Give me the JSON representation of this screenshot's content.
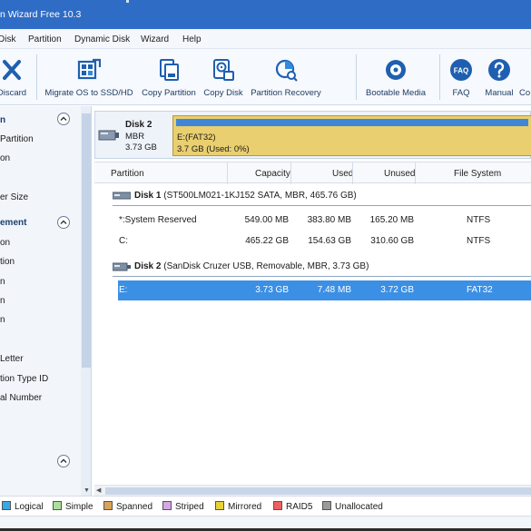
{
  "window": {
    "title": "n Wizard Free 10.3"
  },
  "menu": [
    "Disk",
    "Partition",
    "Dynamic Disk",
    "Wizard",
    "Help"
  ],
  "toolbar": {
    "discard": "Discard",
    "migrate": "Migrate OS to SSD/HD",
    "copy_partition": "Copy Partition",
    "copy_disk": "Copy Disk",
    "partition_recovery": "Partition Recovery",
    "bootable_media": "Bootable Media",
    "faq": "FAQ",
    "faq_icon_text": "FAQ",
    "manual": "Manual",
    "contact": "Co"
  },
  "left_panel": {
    "section1_title": "n",
    "section1_items": [
      "Partition",
      "on",
      "",
      "er Size"
    ],
    "section2_title": "ement",
    "section2_items": [
      "on",
      "tion",
      "n",
      "n",
      "n",
      "",
      "Letter",
      "tion Type ID",
      "al Number",
      ""
    ]
  },
  "disk_map": {
    "name": "Disk 2",
    "type": "MBR",
    "size": "3.73 GB",
    "partition_label": "E:(FAT32)",
    "partition_usage": "3.7 GB (Used: 0%)",
    "used_fraction": 1.0
  },
  "table": {
    "headers": [
      "Partition",
      "Capacity",
      "Used",
      "Unused",
      "File System"
    ],
    "disks": [
      {
        "name": "Disk 1",
        "detail": "(ST500LM021-1KJ152 SATA, MBR, 465.76 GB)",
        "partitions": [
          {
            "partition": "*:System Reserved",
            "capacity": "549.00 MB",
            "used": "383.80 MB",
            "unused": "165.20 MB",
            "fs": "NTFS"
          },
          {
            "partition": "C:",
            "capacity": "465.22 GB",
            "used": "154.63 GB",
            "unused": "310.60 GB",
            "fs": "NTFS"
          }
        ]
      },
      {
        "name": "Disk 2",
        "detail": "(SanDisk Cruzer USB, Removable, MBR, 3.73 GB)",
        "partitions": [
          {
            "partition": "E:",
            "capacity": "3.73 GB",
            "used": "7.48 MB",
            "unused": "3.72 GB",
            "fs": "FAT32",
            "selected": true
          }
        ]
      }
    ]
  },
  "legend": [
    {
      "label": "Logical",
      "color": "#39a9e6"
    },
    {
      "label": "Simple",
      "color": "#a9e09a"
    },
    {
      "label": "Spanned",
      "color": "#d9a25b"
    },
    {
      "label": "Striped",
      "color": "#d6a7e6"
    },
    {
      "label": "Mirrored",
      "color": "#e4d23a"
    },
    {
      "label": "RAID5",
      "color": "#ee5f5f"
    },
    {
      "label": "Unallocated",
      "color": "#9a9a9a"
    }
  ],
  "colors": {
    "accent": "#2f6cc5",
    "selection": "#3b8fe4",
    "fat32_partition": "#e9cf6f"
  }
}
